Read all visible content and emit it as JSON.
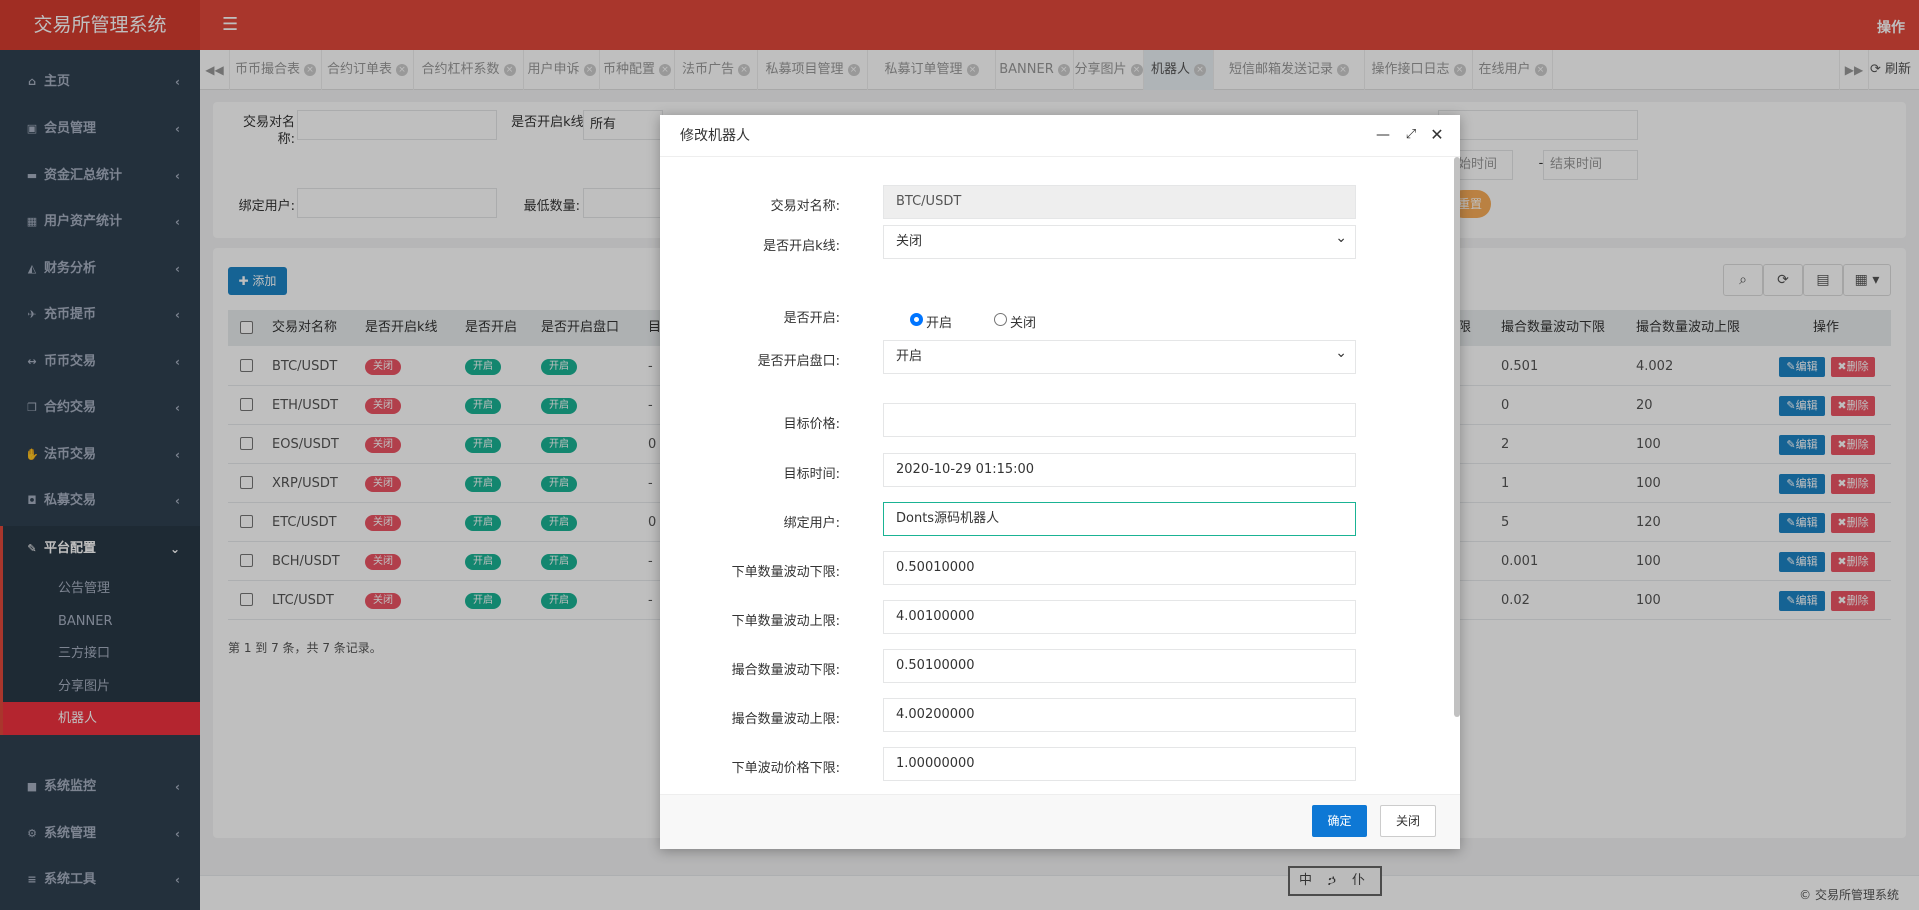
{
  "app": {
    "title": "交易所管理系统",
    "top_action": "操作"
  },
  "sidebar": {
    "items": [
      {
        "label": "主页",
        "icon": "home-icon",
        "glyph": "⌂"
      },
      {
        "label": "会员管理",
        "icon": "user-card-icon",
        "glyph": "▣"
      },
      {
        "label": "资金汇总统计",
        "icon": "card-icon",
        "glyph": "▬"
      },
      {
        "label": "用户资产统计",
        "icon": "building-icon",
        "glyph": "▦"
      },
      {
        "label": "财务分析",
        "icon": "area-chart-icon",
        "glyph": "◭"
      },
      {
        "label": "充币提币",
        "icon": "plane-icon",
        "glyph": "✈"
      },
      {
        "label": "币币交易",
        "icon": "arrows-h-icon",
        "glyph": "↔"
      },
      {
        "label": "合约交易",
        "icon": "clone-icon",
        "glyph": "❐"
      },
      {
        "label": "法币交易",
        "icon": "handshake-icon",
        "glyph": "✋"
      },
      {
        "label": "私募交易",
        "icon": "lock-icon",
        "glyph": "◘"
      },
      {
        "label": "平台配置",
        "icon": "wrench-icon",
        "glyph": "✎"
      }
    ],
    "subitems": [
      "公告管理",
      "BANNER",
      "三方接口",
      "分享图片",
      "机器人"
    ],
    "bottom_items": [
      {
        "label": "系统监控",
        "icon": "video-icon",
        "glyph": "■"
      },
      {
        "label": "系统管理",
        "icon": "gear-icon",
        "glyph": "⚙"
      },
      {
        "label": "系统工具",
        "icon": "bars-icon",
        "glyph": "≡"
      }
    ]
  },
  "tabs": [
    "币币撮合表",
    "合约订单表",
    "合约杠杆系数",
    "用户申诉",
    "币种配置",
    "法币广告",
    "私募项目管理",
    "私募订单管理",
    "BANNER",
    "分享图片",
    "机器人",
    "短信邮箱发送记录",
    "操作接口日志",
    "在线用户"
  ],
  "active_tab": "机器人",
  "refresh_label": "刷新",
  "search_form": {
    "pair_label": "交易对名称:",
    "kline_label": "是否开启k线:",
    "kline_value": "所有",
    "bind_user_label": "绑定用户:",
    "min_qty_label": "最低数量:",
    "start_time_placeholder": "开始时间",
    "time_sep": "-",
    "end_time_placeholder": "结束时间",
    "reset_label": "重置"
  },
  "toolbar": {
    "add_label": "添加"
  },
  "table": {
    "headers": [
      "交易对名称",
      "是否开启k线",
      "是否开启",
      "是否开启盘口",
      "目",
      "限",
      "撮合数量波动下限",
      "撮合数量波动上限",
      "操作"
    ],
    "rows": [
      {
        "pair": "BTC/USDT",
        "kline": "关闭",
        "enabled": "开启",
        "depth": "开启",
        "target": "-",
        "match_min": "0.501",
        "match_max": "4.002"
      },
      {
        "pair": "ETH/USDT",
        "kline": "关闭",
        "enabled": "开启",
        "depth": "开启",
        "target": "-",
        "match_min": "0",
        "match_max": "20"
      },
      {
        "pair": "EOS/USDT",
        "kline": "关闭",
        "enabled": "开启",
        "depth": "开启",
        "target": "0",
        "match_min": "2",
        "match_max": "100"
      },
      {
        "pair": "XRP/USDT",
        "kline": "关闭",
        "enabled": "开启",
        "depth": "开启",
        "target": "-",
        "match_min": "1",
        "match_max": "100"
      },
      {
        "pair": "ETC/USDT",
        "kline": "关闭",
        "enabled": "开启",
        "depth": "开启",
        "target": "0",
        "match_min": "5",
        "match_max": "120"
      },
      {
        "pair": "BCH/USDT",
        "kline": "关闭",
        "enabled": "开启",
        "depth": "开启",
        "target": "-",
        "match_min": "0.001",
        "match_max": "100"
      },
      {
        "pair": "LTC/USDT",
        "kline": "关闭",
        "enabled": "开启",
        "depth": "开启",
        "target": "-",
        "match_min": "0.02",
        "match_max": "100"
      }
    ],
    "edit_label": "编辑",
    "delete_label": "删除",
    "pagination_info": "第 1 到 7 条，共 7 条记录。"
  },
  "footer": {
    "copyright": "© 交易所管理系统",
    "stamp": "中 ኃ 仆"
  },
  "modal": {
    "title": "修改机器人",
    "fields": {
      "pair_label": "交易对名称:",
      "pair_value": "BTC/USDT",
      "kline_label": "是否开启k线:",
      "kline_value": "关闭",
      "enabled_label": "是否开启:",
      "radio_on": "开启",
      "radio_off": "关闭",
      "depth_label": "是否开启盘口:",
      "depth_value": "开启",
      "target_price_label": "目标价格:",
      "target_price_value": "",
      "target_time_label": "目标时间:",
      "target_time_value": "2020-10-29 01:15:00",
      "bind_user_label": "绑定用户:",
      "bind_user_value": "Donts源码机器人",
      "order_min_label": "下单数量波动下限:",
      "order_min_value": "0.50010000",
      "order_max_label": "下单数量波动上限:",
      "order_max_value": "4.00100000",
      "match_min_label": "撮合数量波动下限:",
      "match_min_value": "0.50100000",
      "match_max_label": "撮合数量波动上限:",
      "match_max_value": "4.00200000",
      "price_min_label": "下单波动价格下限:",
      "price_min_value": "1.00000000"
    },
    "confirm_label": "确定",
    "close_label": "关闭"
  }
}
